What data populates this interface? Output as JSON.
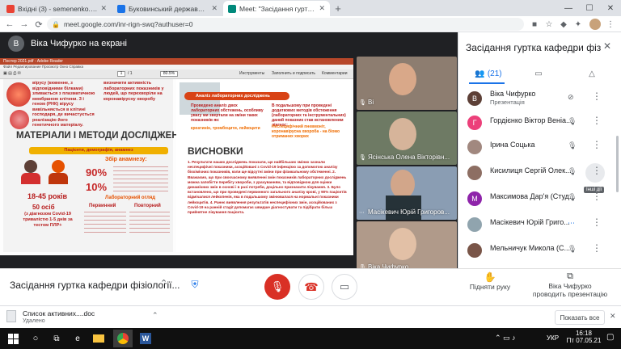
{
  "browser": {
    "tabs": [
      {
        "title": "Вхідні (3) - semenenko.svitlana@",
        "favicon_color": "#ea4335"
      },
      {
        "title": "Буковинський державний меди",
        "favicon_color": "#1a73e8"
      },
      {
        "title": "Meet: \"Засідання гуртка ка",
        "favicon_color": "#00897b"
      }
    ],
    "close_glyph": "✕",
    "new_tab_glyph": "+",
    "url": "meet.google.com/inr-rign-swq?authuser=0",
    "window_controls": {
      "minimize": "—",
      "maximize": "☐",
      "close": "✕"
    }
  },
  "meet": {
    "presenter_initial": "В",
    "presenter_label": "Віка Чифурко на екрані",
    "meeting_title": "Засідання гуртка кафедри фізіології...",
    "controls": {
      "raise_hand_label": "Підняти руку",
      "presenting_label_line1": "Віка Чифурко",
      "presenting_label_line2": "проводить презентацію"
    },
    "tiles": [
      {
        "name": "Ві",
        "bg": "#8d7d70"
      },
      {
        "name": "Ясінська Олена Вікторівн...",
        "bg": "#6e7a64"
      },
      {
        "name": "Масікевич Юрій Григоров...",
        "bg": "#8a9db3"
      },
      {
        "name": "Віка Чифурко",
        "bg": "#b09a8a"
      }
    ]
  },
  "slide": {
    "app_title": "Постер 2021.pdf - Adobe Reader",
    "menu": "Файл   Редактирование   Просмотр   Окно   Справка",
    "page_field": "1",
    "page_total": "/ 1",
    "zoom": "80.5%",
    "toolbar_buttons": [
      "Инструменты",
      "Заполнить и подписать",
      "Комментарии"
    ],
    "intro_text": "вірусу (кювенне, з відповідними білками) зливається з плазматичною мембраною клітини. З і геном (РНК) вірусу вивільняється в клітині господаря, де вичастується реалізацію його генетичного матеріалу.",
    "intro_text_2": "визначити активність лабораторних показників у людей, що перехворіли на коронавірусну хворобу",
    "materials_title": "МАТЕРІАЛИ І МЕТОДИ ДОСЛІДЖЕННЯ",
    "patients_pill": "Пацієнти, демографія, анамнез",
    "age_text": "18-45 років",
    "count_text": "50 осіб",
    "count_sub": "(з діагнозом Covid-19 тривалістю 1-5 днів за тестом ПЛР+",
    "collect_label": "Збір анамнезу:",
    "pct_90": "90%",
    "pct_10": "10%",
    "lab_label": "Лабораторний огляд",
    "primary_label": "Первинний",
    "repeat_label": "Повторний",
    "analysis_pill": "Аналіз лабораторних досліджень",
    "analysis_text": "Проведено аналіз двох лабораторних обстежень, особливу увагу ми звертали на зміни таких показників як:",
    "analysis_highlight": "креатинін, тромбоцити, лейкоцити",
    "analysis_text_2": "В подальшому при проведені додаткових методів обстеження (лабораторних та інструментальних) даний показник став встановленим діагнос:",
    "analysis_highlight_2": "Неспецифічний пневмоніт, коронавірусна хвороба - на біомо отриманих хворих",
    "conclusions_title": "ВИСНОВКИ",
    "conclusions_text": "1. Результати наших досліджень показали, що найбільших зміних зазнали неспецифічні показники, асоційовані з Covid-19 інфекцією за допомогою аналізу біохімічних показників, коли ще відсутні зміни при фізикальному обстеженні. 2. Вважаємо, що при своєчасному виявленні змін показників лабораторних досліджень можна запобігти перебігу хвороби, з урахуванням, та відповідною для оцінки динамічних змін в основі і в разі потреби, доцільно призначити лікування. 3. Було встановлено, що при проведені первинного загального аналізу крові, у 90% пацієнтів відмічалися лейкопенія, яка в подальшому змінювалася на нормальні показники лейкоцитів. 4. Раннє виявлення результатів неспецифічних змін, асоційованих з Covid-19 на ранній стадії допомагає швидше діагностувати та підібрати більш прийнятне лікування пацієнта."
  },
  "panel": {
    "title": "Засідання гуртка кафедри фізіоло...",
    "people_count": "(21)",
    "participants": [
      {
        "name": "Віка Чифурко",
        "sub": "Презентація",
        "initial": "В",
        "color": "#5d4037"
      },
      {
        "name": "Гордієнко Віктор Веніа...",
        "sub": "",
        "initial": "Г",
        "color": "#ec407a"
      },
      {
        "name": "Ірина Соцька",
        "sub": "",
        "initial": "",
        "color": "#a1887f"
      },
      {
        "name": "Кисилиця Сергій Олек...",
        "sub": "",
        "initial": "",
        "color": "#8d6e63"
      },
      {
        "name": "Максимова Дар'я (Студ...",
        "sub": "",
        "initial": "М",
        "color": "#8e24aa"
      },
      {
        "name": "Масікевич Юрій Григо...",
        "sub": "",
        "initial": "",
        "color": "#90a4ae"
      },
      {
        "name": "Мельничук Микола (С...",
        "sub": "",
        "initial": "",
        "color": "#795548"
      }
    ],
    "more_options_tooltip": "Інші дії"
  },
  "downloads": {
    "file_name": "Список активних....doc",
    "file_status": "Удалено",
    "show_all": "Показать все",
    "close_glyph": "✕"
  },
  "taskbar": {
    "lang": "УКР",
    "time": "16:18",
    "date": "Пт 07.05.21"
  }
}
